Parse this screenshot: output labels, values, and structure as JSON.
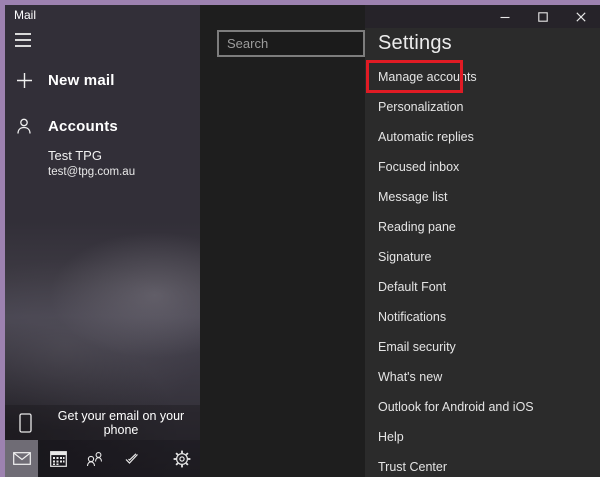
{
  "window": {
    "app_title": "Mail",
    "controls": {
      "minimize": "minimize",
      "maximize": "maximize",
      "close": "close"
    }
  },
  "sidebar": {
    "new_mail": {
      "label": "New mail"
    },
    "accounts_header": {
      "label": "Accounts"
    },
    "account": {
      "name": "Test TPG",
      "email": "test@tpg.com.au"
    },
    "phone_promo": {
      "label": "Get your email on your phone"
    },
    "nav": {
      "items": [
        {
          "name": "mail-icon",
          "selected": true
        },
        {
          "name": "calendar-icon",
          "selected": false
        },
        {
          "name": "people-icon",
          "selected": false
        },
        {
          "name": "todo-check-icon",
          "selected": false
        },
        {
          "name": "settings-gear-icon",
          "selected": false
        }
      ]
    }
  },
  "content": {
    "search": {
      "placeholder": "Search"
    }
  },
  "settings": {
    "title": "Settings",
    "items": [
      {
        "label": "Manage accounts",
        "highlighted": true
      },
      {
        "label": "Personalization",
        "highlighted": false
      },
      {
        "label": "Automatic replies",
        "highlighted": false
      },
      {
        "label": "Focused inbox",
        "highlighted": false
      },
      {
        "label": "Message list",
        "highlighted": false
      },
      {
        "label": "Reading pane",
        "highlighted": false
      },
      {
        "label": "Signature",
        "highlighted": false
      },
      {
        "label": "Default Font",
        "highlighted": false
      },
      {
        "label": "Notifications",
        "highlighted": false
      },
      {
        "label": "Email security",
        "highlighted": false
      },
      {
        "label": "What's new",
        "highlighted": false
      },
      {
        "label": "Outlook for Android and iOS",
        "highlighted": false
      },
      {
        "label": "Help",
        "highlighted": false
      },
      {
        "label": "Trust Center",
        "highlighted": false
      }
    ]
  },
  "colors": {
    "accent_border": "#9d82b0",
    "highlight_red": "#e01b24",
    "sidebar_bg": "#322f38",
    "middle_bg": "#1e1e1e",
    "panel_bg": "#2b2b2b",
    "titlebar_bg": "#262329",
    "nav_selected_bg": "#6f6c75"
  }
}
